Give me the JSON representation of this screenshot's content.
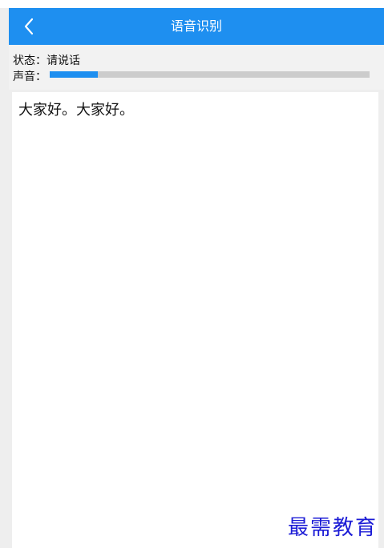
{
  "appbar": {
    "title": "语音识别",
    "back_icon": "chevron-left-icon",
    "background_color": "#1e8ff0"
  },
  "status": {
    "text": "状态：请说话"
  },
  "volume": {
    "label": "声音：",
    "level_percent": 15,
    "fill_color": "#1e8ff0",
    "track_color": "#cccccc"
  },
  "result": {
    "text": "大家好。大家好。"
  },
  "watermark": {
    "text": "最需教育",
    "color": "#1c1cd6"
  }
}
